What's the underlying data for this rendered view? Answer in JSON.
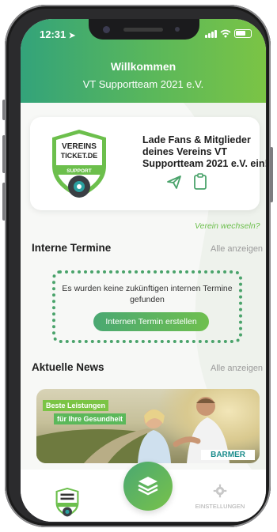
{
  "status_bar": {
    "time": "12:31"
  },
  "header": {
    "welcome": "Willkommen",
    "club_name": "VT Supportteam 2021 e.V."
  },
  "promo": {
    "logo": {
      "line1": "VEREINS",
      "line2": "TICKET.DE",
      "ribbon": "SUPPORT"
    },
    "text": "Lade Fans & Mitglieder deines Vereins VT Supportteam 2021 e.V. ein!",
    "icons": [
      "send-icon",
      "clipboard-icon"
    ]
  },
  "switch_club_link": "Verein wechseln?",
  "internal_events": {
    "title": "Interne Termine",
    "show_all": "Alle anzeigen",
    "empty_message": "Es wurden keine zukünftigen internen Termine gefunden",
    "create_button": "Internen Termin erstellen"
  },
  "news": {
    "title": "Aktuelle News",
    "show_all": "Alle anzeigen",
    "banner": {
      "tag1": "Beste Leistungen",
      "tag2": "für Ihre Gesundheit",
      "brand": "BARMER"
    }
  },
  "tabbar": {
    "center_icon": "layers-icon",
    "settings_label": "EINSTELLUNGEN",
    "settings_icon": "gear-icon"
  },
  "colors": {
    "primary_green": "#4aa36b",
    "accent_green": "#7bc445",
    "header_teal": "#33a37a"
  }
}
